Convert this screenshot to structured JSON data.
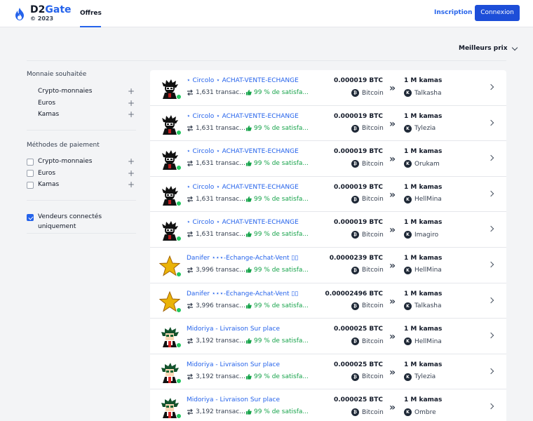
{
  "header": {
    "logo_prefix": "D2",
    "logo_accent": "Gate",
    "copyright": "© 2023",
    "tab_offers": "Offres",
    "signup": "Inscription",
    "login": "Connexion"
  },
  "sort": {
    "label": "Meilleurs prix"
  },
  "filters": {
    "currency_title": "Monnaie souhaitée",
    "currency_items": [
      "Crypto-monnaies",
      "Euros",
      "Kamas"
    ],
    "payment_title": "Méthodes de paiement",
    "payment_items": [
      "Crypto-monnaies",
      "Euros",
      "Kamas"
    ],
    "online_only": "Vendeurs connectés uniquement"
  },
  "colors": {
    "accent": "#2563eb",
    "online": "#22c55e",
    "satisfaction": "#16a34a"
  },
  "offers": [
    {
      "seller": "⋆ Circolo ⋆ ACHAT-VENTE-ECHANGE",
      "avatar": "dark-character",
      "transactions": "1,631 transac...",
      "satisfaction": "99 % de satisfa...",
      "price": "0.000019 BTC",
      "method": "Bitcoin",
      "amount": "1 M kamas",
      "server": "Talkasha"
    },
    {
      "seller": "⋆ Circolo ⋆ ACHAT-VENTE-ECHANGE",
      "avatar": "dark-character",
      "transactions": "1,631 transac...",
      "satisfaction": "99 % de satisfa...",
      "price": "0.000019 BTC",
      "method": "Bitcoin",
      "amount": "1 M kamas",
      "server": "Tylezia"
    },
    {
      "seller": "⋆ Circolo ⋆ ACHAT-VENTE-ECHANGE",
      "avatar": "dark-character",
      "transactions": "1,631 transac...",
      "satisfaction": "99 % de satisfa...",
      "price": "0.000019 BTC",
      "method": "Bitcoin",
      "amount": "1 M kamas",
      "server": "Orukam"
    },
    {
      "seller": "⋆ Circolo ⋆ ACHAT-VENTE-ECHANGE",
      "avatar": "dark-character",
      "transactions": "1,631 transac...",
      "satisfaction": "99 % de satisfa...",
      "price": "0.000019 BTC",
      "method": "Bitcoin",
      "amount": "1 M kamas",
      "server": "HellMina"
    },
    {
      "seller": "⋆ Circolo ⋆ ACHAT-VENTE-ECHANGE",
      "avatar": "dark-character",
      "transactions": "1,631 transac...",
      "satisfaction": "99 % de satisfa...",
      "price": "0.000019 BTC",
      "method": "Bitcoin",
      "amount": "1 M kamas",
      "server": "Imagiro"
    },
    {
      "seller": "Danifer ⋆⋆⋆-Echange-Achat-Vent ▯▯",
      "avatar": "gold-star",
      "transactions": "3,996 transac...",
      "satisfaction": "99 % de satisfa...",
      "price": "0.0000239 BTC",
      "method": "Bitcoin",
      "amount": "1 M kamas",
      "server": "HellMina"
    },
    {
      "seller": "Danifer ⋆⋆⋆-Echange-Achat-Vent ▯▯",
      "avatar": "gold-star",
      "transactions": "3,996 transac...",
      "satisfaction": "99 % de satisfa...",
      "price": "0.00002496 BTC",
      "method": "Bitcoin",
      "amount": "1 M kamas",
      "server": "Talkasha"
    },
    {
      "seller": "Midoriya - Livraison Sur place",
      "avatar": "green-hair-character",
      "transactions": "3,192 transac...",
      "satisfaction": "99 % de satisfa...",
      "price": "0.000025 BTC",
      "method": "Bitcoin",
      "amount": "1 M kamas",
      "server": "HellMina"
    },
    {
      "seller": "Midoriya - Livraison Sur place",
      "avatar": "green-hair-character",
      "transactions": "3,192 transac...",
      "satisfaction": "99 % de satisfa...",
      "price": "0.000025 BTC",
      "method": "Bitcoin",
      "amount": "1 M kamas",
      "server": "Tylezia"
    },
    {
      "seller": "Midoriya - Livraison Sur place",
      "avatar": "green-hair-character",
      "transactions": "3,192 transac...",
      "satisfaction": "99 % de satisfa...",
      "price": "0.000025 BTC",
      "method": "Bitcoin",
      "amount": "1 M kamas",
      "server": "Ombre"
    }
  ]
}
